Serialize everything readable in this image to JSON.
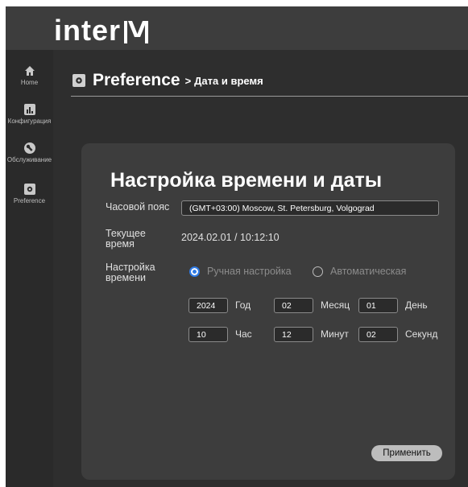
{
  "brand": {
    "logo_text": "inter",
    "logo_mark_icon": "m-logo-mark"
  },
  "sidebar": {
    "items": [
      {
        "label": "Home",
        "icon": "home-icon"
      },
      {
        "label": "Конфигурация",
        "icon": "chart-icon"
      },
      {
        "label": "Обслуживание",
        "icon": "wrench-icon"
      },
      {
        "label": "Preference",
        "icon": "gear-icon"
      }
    ]
  },
  "header": {
    "title": "Preference",
    "separator": ">",
    "subtitle": "Дата и время"
  },
  "panel": {
    "title": "Настройка времени и даты",
    "timezone_label": "Часовой пояс",
    "timezone_value": "(GMT+03:00) Moscow, St. Petersburg, Volgograd",
    "current_time_label": "Текущее время",
    "current_time_value": "2024.02.01 / 10:12:10",
    "time_setting_label": "Настройка времени",
    "mode_manual": "Ручная настройка",
    "mode_auto": "Автоматическая",
    "selected_mode": "manual",
    "year_value": "2024",
    "year_unit": "Год",
    "month_value": "02",
    "month_unit": "Месяц",
    "day_value": "01",
    "day_unit": "День",
    "hour_value": "10",
    "hour_unit": "Час",
    "minute_value": "12",
    "minute_unit": "Минут",
    "second_value": "02",
    "second_unit": "Секунд",
    "apply_label": "Применить"
  },
  "colors": {
    "accent": "#2f7be6",
    "background": "#2e2e2e",
    "panel": "#3d3d3d"
  }
}
